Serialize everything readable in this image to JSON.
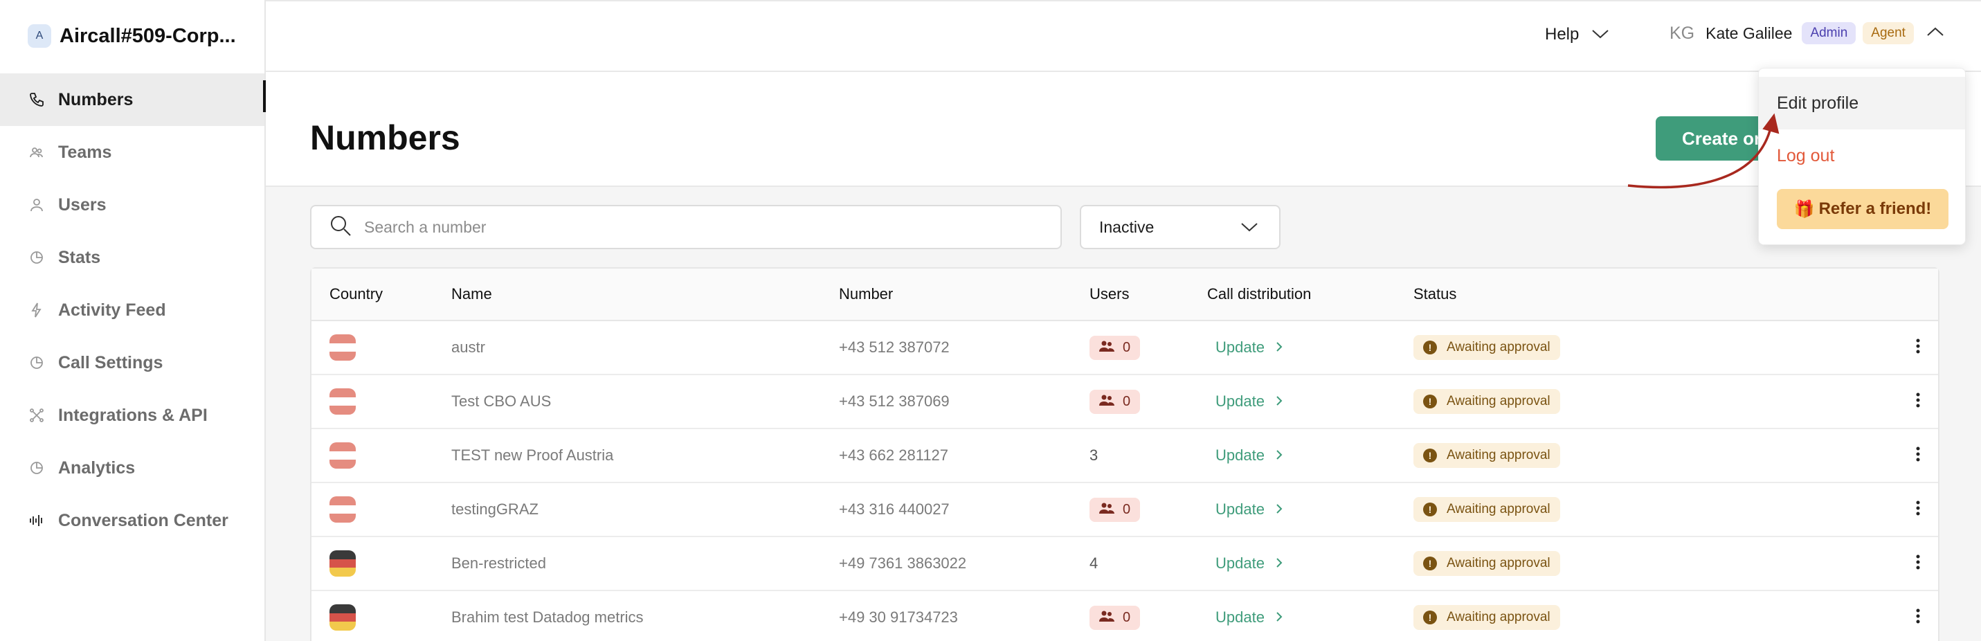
{
  "workspace": {
    "avatar_letter": "A",
    "name": "Aircall#509-Corp..."
  },
  "sidebar": {
    "items": [
      {
        "label": "Numbers",
        "icon": "phone-icon",
        "active": true
      },
      {
        "label": "Teams",
        "icon": "team-icon",
        "active": false
      },
      {
        "label": "Users",
        "icon": "user-icon",
        "active": false
      },
      {
        "label": "Stats",
        "icon": "stats-icon",
        "active": false
      },
      {
        "label": "Activity Feed",
        "icon": "lightning-icon",
        "active": false
      },
      {
        "label": "Call Settings",
        "icon": "settings-icon",
        "active": false
      },
      {
        "label": "Integrations & API",
        "icon": "integrations-icon",
        "active": false
      },
      {
        "label": "Analytics",
        "icon": "analytics-icon",
        "active": false
      },
      {
        "label": "Conversation Center",
        "icon": "waveform-icon",
        "active": false
      }
    ]
  },
  "topbar": {
    "help_label": "Help",
    "user_initials": "KG",
    "user_name": "Kate Galilee",
    "badges": [
      "Admin",
      "Agent"
    ]
  },
  "page": {
    "title": "Numbers",
    "create_button": "Create or"
  },
  "filters": {
    "search_placeholder": "Search a number",
    "status_value": "Inactive"
  },
  "table": {
    "headers": [
      "Country",
      "Name",
      "Number",
      "Users",
      "Call distribution",
      "Status"
    ],
    "rows": [
      {
        "flag": "austria",
        "name": "austr",
        "number": "+43 512 387072",
        "users": "0",
        "users_badge": true,
        "distribution": "Update",
        "status": "Awaiting approval"
      },
      {
        "flag": "austria",
        "name": "Test CBO AUS",
        "number": "+43 512 387069",
        "users": "0",
        "users_badge": true,
        "distribution": "Update",
        "status": "Awaiting approval"
      },
      {
        "flag": "austria",
        "name": "TEST new Proof Austria",
        "number": "+43 662 281127",
        "users": "3",
        "users_badge": false,
        "distribution": "Update",
        "status": "Awaiting approval"
      },
      {
        "flag": "austria",
        "name": "testingGRAZ",
        "number": "+43 316 440027",
        "users": "0",
        "users_badge": true,
        "distribution": "Update",
        "status": "Awaiting approval"
      },
      {
        "flag": "germany",
        "name": "Ben-restricted",
        "number": "+49 7361 3863022",
        "users": "4",
        "users_badge": false,
        "distribution": "Update",
        "status": "Awaiting approval"
      },
      {
        "flag": "germany",
        "name": "Brahim test Datadog metrics",
        "number": "+49 30 91734723",
        "users": "0",
        "users_badge": true,
        "distribution": "Update",
        "status": "Awaiting approval"
      }
    ]
  },
  "dropdown": {
    "edit_profile": "Edit profile",
    "log_out": "Log out",
    "refer": "Refer a friend!"
  },
  "colors": {
    "accent": "#3f9c7b",
    "logout": "#e2593a",
    "annotation_arrow": "#a8281e",
    "status_bg": "#fbf0dc"
  }
}
